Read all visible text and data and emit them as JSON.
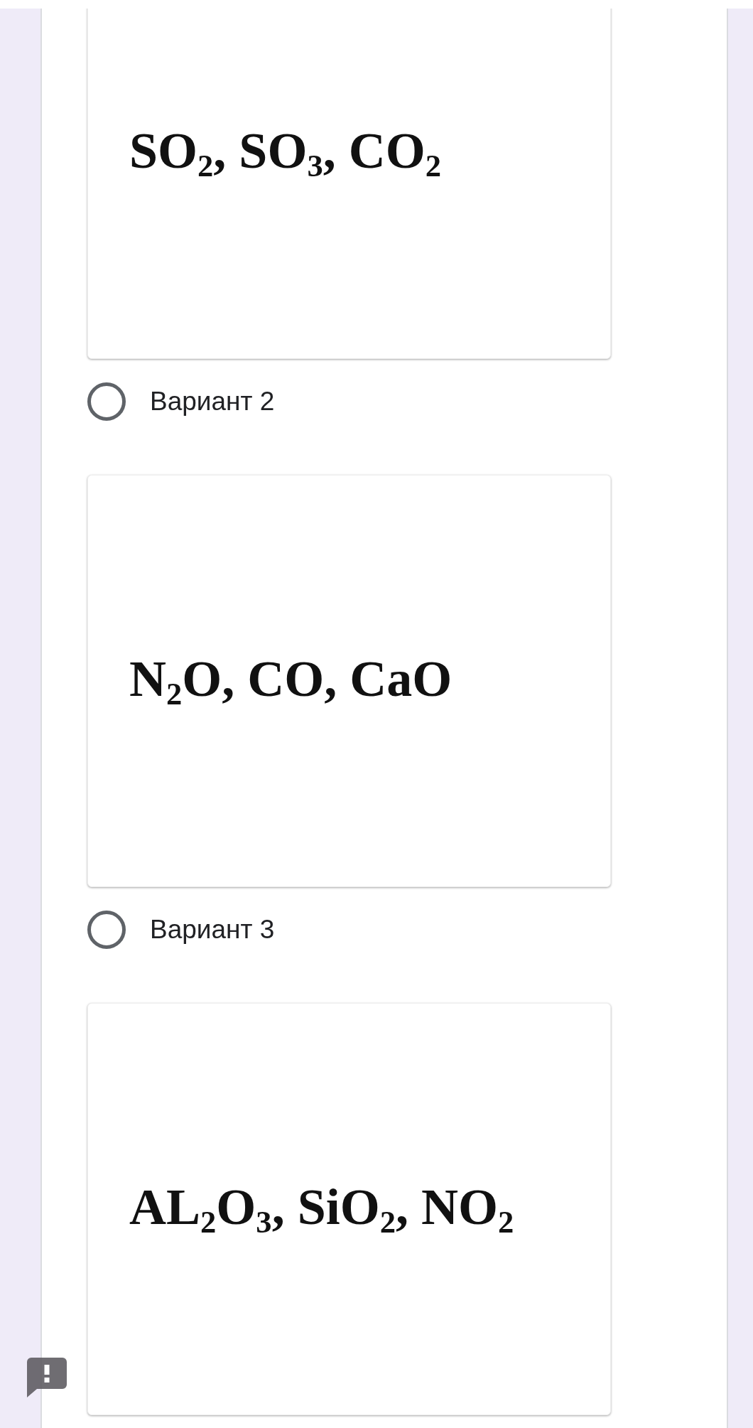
{
  "items": [
    {
      "kind": "image",
      "formula": "SO$_{2}$, SO$_{3}$, CO$_{2}$"
    },
    {
      "kind": "option",
      "label": "Вариант 2",
      "selected": false
    },
    {
      "kind": "image",
      "formula": "N$_{2}$O, CO, CaO"
    },
    {
      "kind": "option",
      "label": "Вариант 3",
      "selected": false
    },
    {
      "kind": "image",
      "formula": "AL$_{2}$O$_{3}$, SiO$_{2}$, NO$_{2}$"
    }
  ],
  "feedback_button": {
    "kind": "report"
  }
}
